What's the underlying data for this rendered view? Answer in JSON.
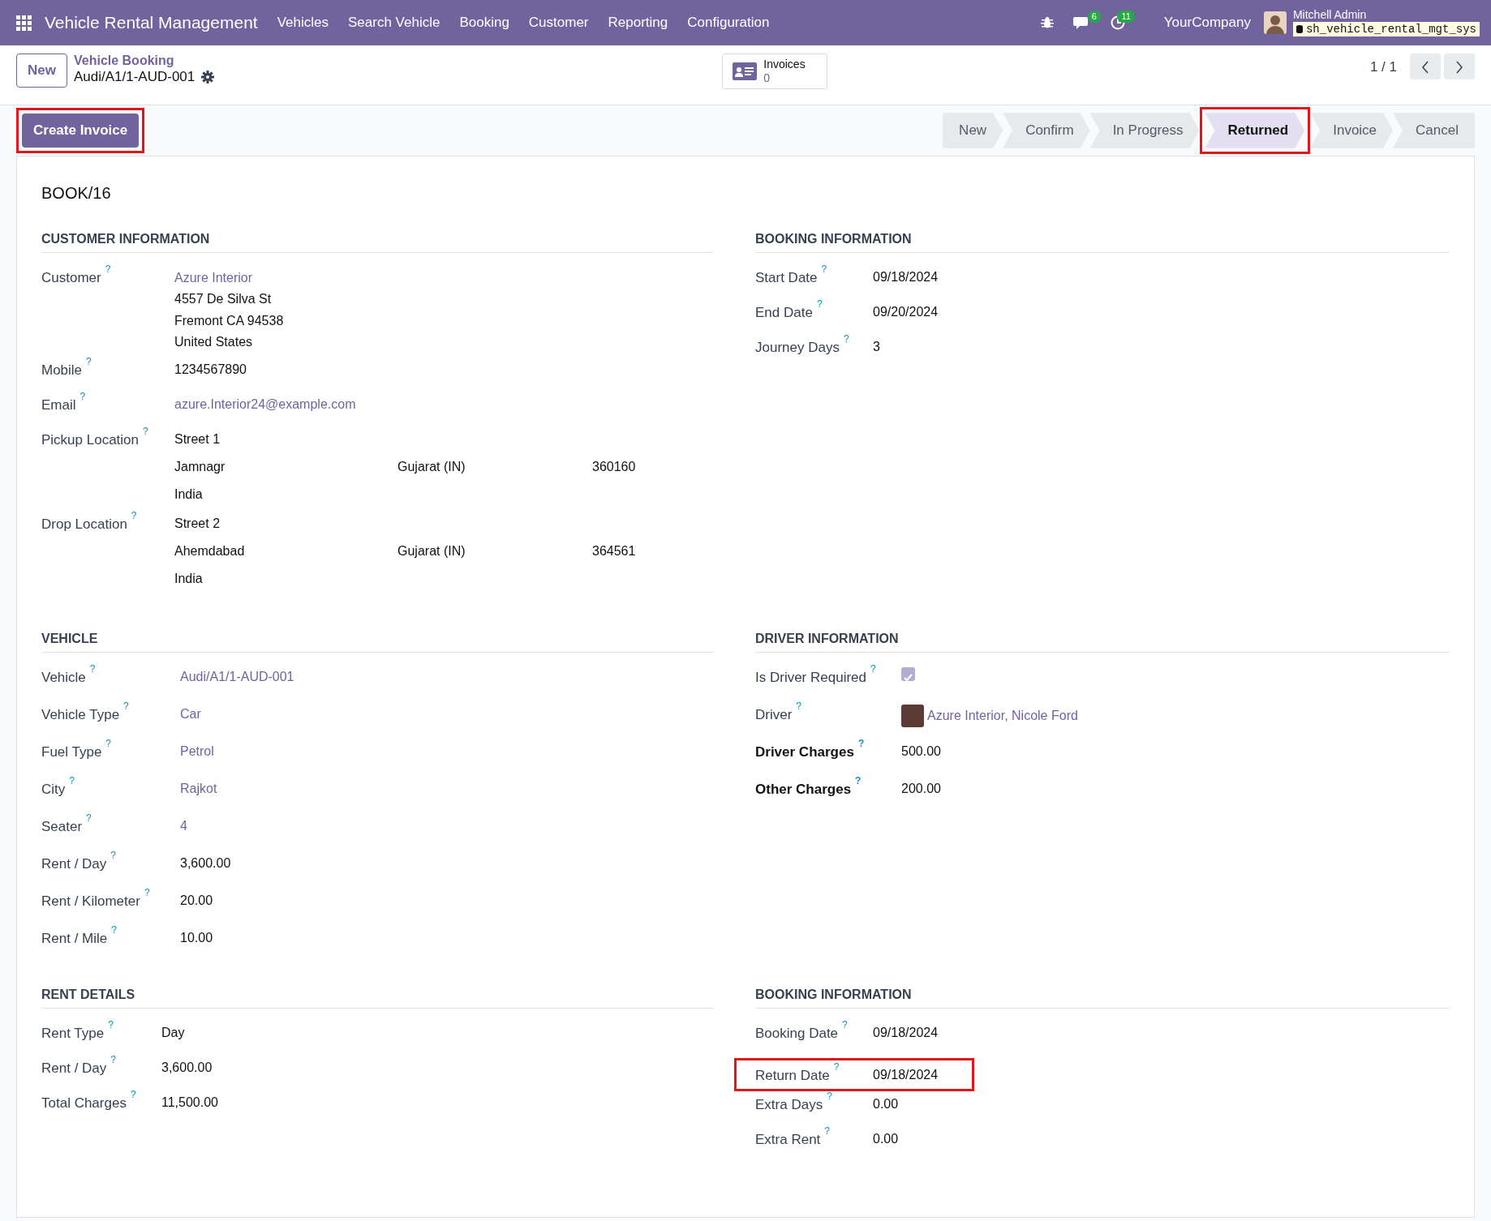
{
  "navbar": {
    "app_title": "Vehicle Rental Management",
    "menus": [
      "Vehicles",
      "Search Vehicle",
      "Booking",
      "Customer",
      "Reporting",
      "Configuration"
    ],
    "messages_count": "6",
    "activities_count": "11",
    "company": "YourCompany",
    "user": "Mitchell Admin",
    "database": "sh_vehicle_rental_mgt_sys"
  },
  "control_panel": {
    "new_button": "New",
    "breadcrumb": "Vehicle Booking",
    "record": "Audi/A1/1-AUD-001",
    "smart_button": {
      "label": "Invoices",
      "count": "0"
    },
    "pager": "1 / 1"
  },
  "actions": [
    {
      "label": "Create Invoice",
      "highlighted": true
    }
  ],
  "stages": [
    {
      "label": "New",
      "selected": false,
      "highlighted": false
    },
    {
      "label": "Confirm",
      "selected": false,
      "highlighted": false
    },
    {
      "label": "In Progress",
      "selected": false,
      "highlighted": false
    },
    {
      "label": "Returned",
      "selected": true,
      "highlighted": true
    },
    {
      "label": "Invoice",
      "selected": false,
      "highlighted": false
    },
    {
      "label": "Cancel",
      "selected": false,
      "highlighted": false
    }
  ],
  "sheet": {
    "title": "BOOK/16",
    "sections": [
      {
        "title": "CUSTOMER INFORMATION",
        "fields": [
          {
            "kind": "contact",
            "label": "Customer",
            "help": "?",
            "value": "Azure Interior",
            "lines": [
              "4557 De Silva St",
              "Fremont CA 94538",
              "United States"
            ]
          },
          {
            "kind": "text",
            "label": "Mobile",
            "help": "?",
            "value": "1234567890"
          },
          {
            "kind": "link",
            "label": "Email",
            "help": "?",
            "value": "azure.Interior24@example.com"
          },
          {
            "kind": "address",
            "label": "Pickup Location",
            "help": "?",
            "street": "Street 1",
            "city": "Jamnagr",
            "state": "Gujarat (IN)",
            "zip": "360160",
            "country": "India"
          },
          {
            "kind": "address",
            "label": "Drop Location",
            "help": "?",
            "street": "Street 2",
            "city": "Ahemdabad",
            "state": "Gujarat (IN)",
            "zip": "364561",
            "country": "India"
          }
        ]
      },
      {
        "title": "BOOKING INFORMATION",
        "fields": [
          {
            "kind": "text",
            "label": "Start Date",
            "help": "?",
            "value": "09/18/2024"
          },
          {
            "kind": "text",
            "label": "End Date",
            "help": "?",
            "value": "09/20/2024"
          },
          {
            "kind": "text",
            "label": "Journey Days",
            "help": "?",
            "value": "3"
          }
        ]
      },
      {
        "title": "VEHICLE",
        "fields": [
          {
            "kind": "link",
            "label": "Vehicle",
            "help": "?",
            "value": "Audi/A1/1-AUD-001"
          },
          {
            "kind": "link",
            "label": "Vehicle Type",
            "help": "?",
            "value": "Car"
          },
          {
            "kind": "link",
            "label": "Fuel Type",
            "help": "?",
            "value": "Petrol"
          },
          {
            "kind": "link",
            "label": "City",
            "help": "?",
            "value": "Rajkot"
          },
          {
            "kind": "link",
            "label": "Seater",
            "help": "?",
            "value": "4"
          },
          {
            "kind": "text",
            "label": "Rent / Day",
            "help": "?",
            "value": "3,600.00"
          },
          {
            "kind": "text",
            "label": "Rent / Kilometer",
            "help": "?",
            "value": "20.00"
          },
          {
            "kind": "text",
            "label": "Rent / Mile",
            "help": "?",
            "value": "10.00"
          }
        ]
      },
      {
        "title": "DRIVER INFORMATION",
        "fields": [
          {
            "kind": "checkbox",
            "label": "Is Driver Required",
            "help": "?",
            "checked": true
          },
          {
            "kind": "avatar_link",
            "label": "Driver",
            "help": "?",
            "value": "Azure Interior, Nicole Ford"
          },
          {
            "kind": "text",
            "label": "Driver Charges",
            "help": "?",
            "value": "500.00",
            "strong": true
          },
          {
            "kind": "text",
            "label": "Other Charges",
            "help": "?",
            "value": "200.00",
            "strong": true
          }
        ]
      },
      {
        "title": "RENT DETAILS",
        "fields": [
          {
            "kind": "text",
            "label": "Rent Type",
            "help": "?",
            "value": "Day"
          },
          {
            "kind": "text",
            "label": "Rent / Day",
            "help": "?",
            "value": "3,600.00"
          },
          {
            "kind": "text",
            "label": "Total Charges",
            "help": "?",
            "value": "11,500.00"
          }
        ]
      },
      {
        "title": "BOOKING INFORMATION",
        "fields": [
          {
            "kind": "text",
            "label": "Booking Date",
            "help": "?",
            "value": "09/18/2024"
          },
          {
            "kind": "text",
            "label": "Return Date",
            "help": "?",
            "value": "09/18/2024",
            "highlighted": true
          },
          {
            "kind": "text",
            "label": "Extra Days",
            "help": "?",
            "value": "0.00"
          },
          {
            "kind": "text",
            "label": "Extra Rent",
            "help": "?",
            "value": "0.00"
          }
        ]
      }
    ]
  }
}
